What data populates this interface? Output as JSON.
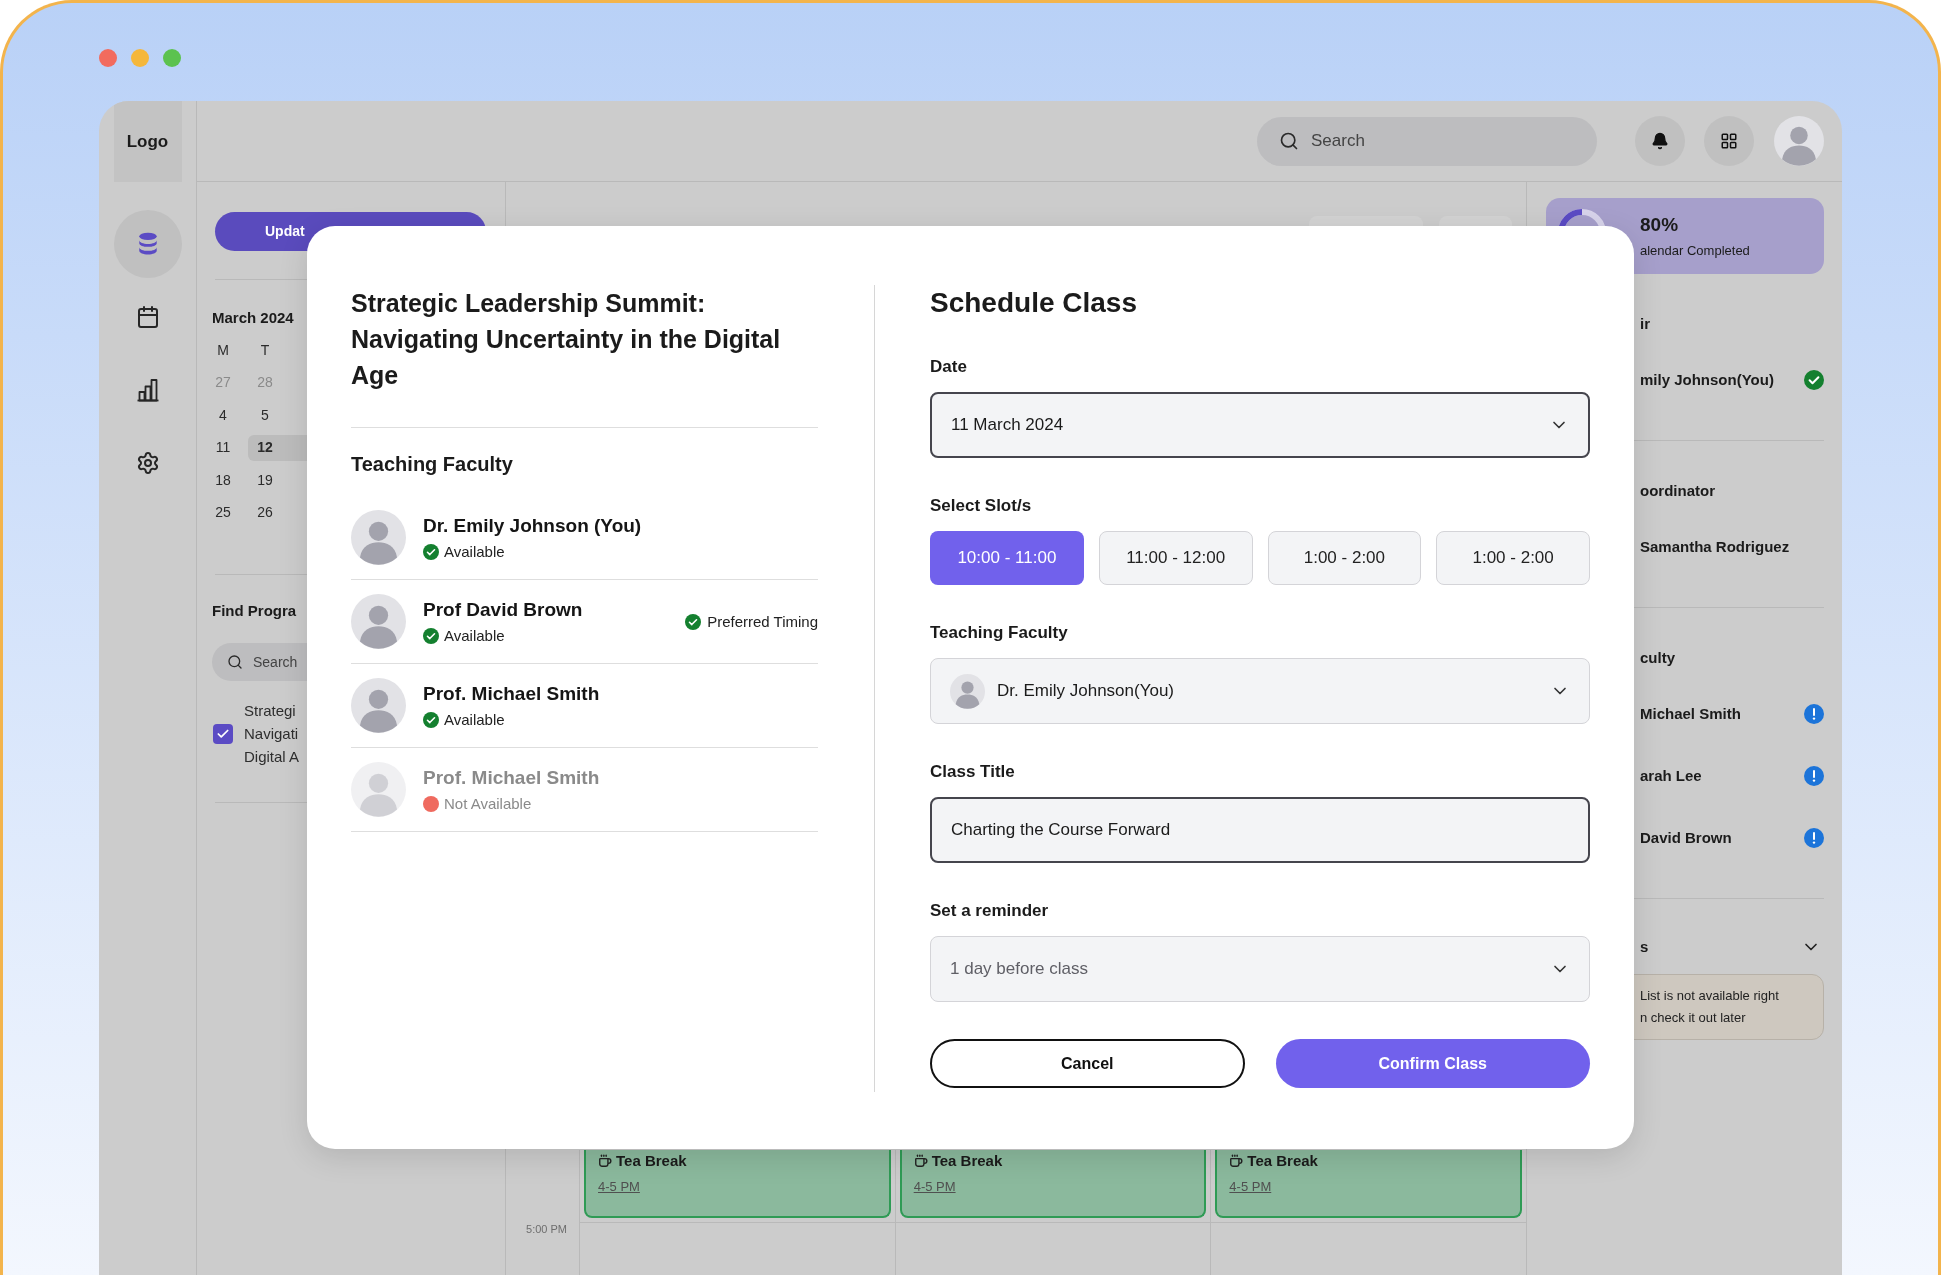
{
  "logo": "Logo",
  "rail": [
    {
      "selected": true
    },
    {
      "selected": false
    },
    {
      "selected": false
    },
    {
      "selected": false
    }
  ],
  "top_bar": {
    "search": {
      "placeholder": "Search"
    }
  },
  "calendar_panel": {
    "update_button": "Updat",
    "month": "March 2024",
    "weekdays": [
      "M",
      "T"
    ],
    "weeks": [
      [
        {
          "day": "27",
          "outside_month": true,
          "selected": false
        },
        {
          "day": "28",
          "outside_month": true,
          "selected": false
        }
      ],
      [
        {
          "day": "4",
          "outside_month": false,
          "selected": false
        },
        {
          "day": "5",
          "outside_month": false,
          "selected": false
        }
      ],
      [
        {
          "day": "11",
          "outside_month": false,
          "selected": false
        },
        {
          "day": "12",
          "outside_month": false,
          "selected": true
        }
      ],
      [
        {
          "day": "18",
          "outside_month": false,
          "selected": false
        },
        {
          "day": "19",
          "outside_month": false,
          "selected": false
        }
      ],
      [
        {
          "day": "25",
          "outside_month": false,
          "selected": false
        },
        {
          "day": "26",
          "outside_month": false,
          "selected": false
        }
      ]
    ],
    "find_heading": "Find Progra",
    "search": {
      "placeholder": "Search"
    },
    "programs": [
      {
        "lines": [
          "Strategi",
          "Navigati",
          "Digital A"
        ],
        "checked": true
      }
    ]
  },
  "calendar_view": {
    "time_label": "5:00 PM",
    "events": [
      {
        "title": "Tea Break",
        "time": "4-5 PM"
      },
      {
        "title": "Tea Break",
        "time": "4-5 PM"
      },
      {
        "title": "Tea Break",
        "time": "4-5 PM"
      }
    ]
  },
  "right_panel": {
    "progress": {
      "value": "80%",
      "caption": "alendar Completed"
    },
    "sections": [
      {
        "title": "ir",
        "people": [
          {
            "name": "mily Johnson(You)",
            "confirmed": true
          }
        ]
      },
      {
        "title": "oordinator",
        "people": [
          {
            "name": "Samantha Rodriguez"
          }
        ]
      },
      {
        "title": "culty",
        "people": [
          {
            "name": "Michael Smith",
            "confirmed": false
          },
          {
            "name": "arah Lee",
            "confirmed": false
          },
          {
            "name": "David Brown",
            "confirmed": false
          }
        ]
      }
    ],
    "collapsible": {
      "title": "s",
      "expanded": true,
      "notice_lines": [
        "List is not available right",
        "n check it out later"
      ]
    }
  },
  "modal": {
    "program_title": "Strategic Leadership Summit: Navigating Uncertainty in the Digital Age",
    "faculty_heading": "Teaching Faculty",
    "faculty": [
      {
        "name": "Dr. Emily Johnson (You)",
        "status": "Available",
        "available": true
      },
      {
        "name": "Prof David Brown",
        "status": "Available",
        "available": true,
        "note": "Preferred Timing"
      },
      {
        "name": "Prof. Michael Smith",
        "status": "Available",
        "available": true
      },
      {
        "name": "Prof. Michael Smith",
        "status": "Not Available",
        "available": false
      }
    ],
    "form": {
      "title": "Schedule Class",
      "fields": [
        {
          "kind": "select",
          "label": "Date",
          "value": "11 March 2024",
          "highlighted": true
        },
        {
          "kind": "slots",
          "label": "Select Slot/s",
          "options": [
            {
              "label": "10:00 - 11:00",
              "selected": true
            },
            {
              "label": "11:00 - 12:00",
              "selected": false
            },
            {
              "label": "1:00 - 2:00",
              "selected": false
            },
            {
              "label": "1:00 - 2:00",
              "selected": false
            }
          ]
        },
        {
          "kind": "person_select",
          "label": "Teaching Faculty",
          "value": "Dr. Emily Johnson(You)",
          "highlighted": false
        },
        {
          "kind": "text",
          "label": "Class Title",
          "value": "Charting the Course Forward",
          "highlighted": true
        },
        {
          "kind": "select",
          "label": "Set a reminder",
          "placeholder": "1 day before class",
          "highlighted": false
        }
      ],
      "buttons": [
        {
          "label": "Cancel",
          "kind": "secondary"
        },
        {
          "label": "Confirm Class",
          "kind": "primary"
        }
      ]
    }
  }
}
